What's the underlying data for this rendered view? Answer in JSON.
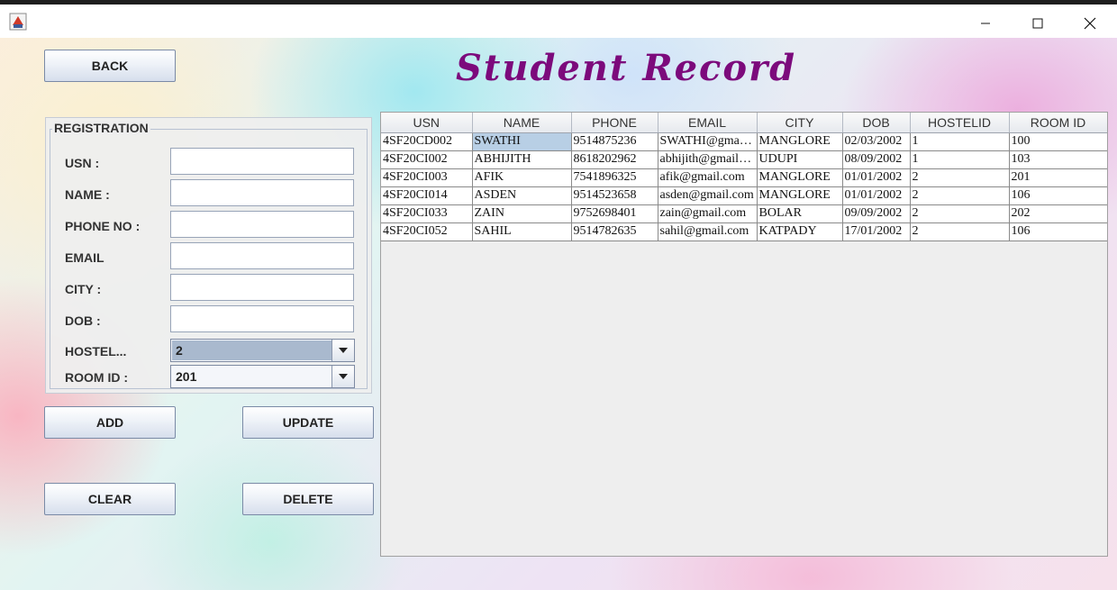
{
  "window": {
    "minimize_glyph": "—",
    "maximize_glyph": "☐",
    "close_glyph": "✕"
  },
  "title": "Student Record",
  "buttons": {
    "back": "BACK",
    "add": "ADD",
    "update": "UPDATE",
    "clear": "CLEAR",
    "delete": "DELETE"
  },
  "registration": {
    "legend": "REGISTRATION",
    "usn": {
      "label": "USN :",
      "value": ""
    },
    "name": {
      "label": "NAME :",
      "value": ""
    },
    "phone": {
      "label": "PHONE NO :",
      "value": ""
    },
    "email": {
      "label": "EMAIL",
      "value": ""
    },
    "city": {
      "label": "CITY :",
      "value": ""
    },
    "dob": {
      "label": "DOB :",
      "value": ""
    },
    "hostel": {
      "label": "HOSTEL...",
      "selected": "2"
    },
    "room": {
      "label": "ROOM ID :",
      "selected": "201"
    }
  },
  "table": {
    "columns": [
      "USN",
      "NAME",
      "PHONE",
      "EMAIL",
      "CITY",
      "DOB",
      "HOSTELID",
      "ROOM ID"
    ],
    "rows": [
      [
        "4SF20CD002",
        "SWATHI",
        "9514875236",
        "SWATHI@gmail.com",
        "MANGLORE",
        "02/03/2002",
        "1",
        "100"
      ],
      [
        "4SF20CI002",
        "ABHIJITH",
        "8618202962",
        "abhijith@gmail.com",
        "UDUPI",
        "08/09/2002",
        "1",
        "103"
      ],
      [
        "4SF20CI003",
        "AFIK",
        "7541896325",
        "afik@gmail.com",
        "MANGLORE",
        "01/01/2002",
        "2",
        "201"
      ],
      [
        "4SF20CI014",
        "ASDEN",
        "9514523658",
        "asden@gmail.com",
        "MANGLORE",
        "01/01/2002",
        "2",
        "106"
      ],
      [
        "4SF20CI033",
        "ZAIN",
        "9752698401",
        "zain@gmail.com",
        "BOLAR",
        "09/09/2002",
        "2",
        "202"
      ],
      [
        "4SF20CI052",
        "SAHIL",
        "9514782635",
        "sahil@gmail.com",
        "KATPADY",
        "17/01/2002",
        "2",
        "106"
      ]
    ],
    "selected_cell": {
      "row": 0,
      "col": 1
    }
  },
  "colors": {
    "title": "#7c0a7c",
    "selection": "#b8cfe5",
    "combo_selection": "#a9b9ce"
  },
  "icons": {
    "app": "java-cup-icon",
    "dropdown": "chevron-down-icon"
  }
}
